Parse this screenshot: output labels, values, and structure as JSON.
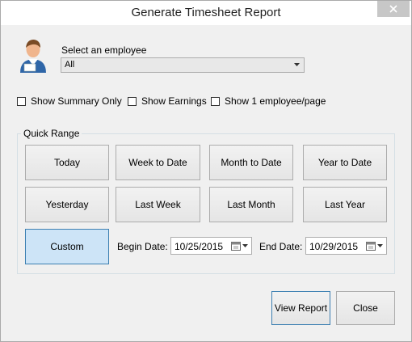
{
  "window": {
    "title": "Generate Timesheet Report"
  },
  "employee": {
    "label": "Select an employee",
    "selected": "All"
  },
  "options": [
    {
      "label": "Show Summary Only",
      "checked": false
    },
    {
      "label": "Show Earnings",
      "checked": false
    },
    {
      "label": "Show 1 employee/page",
      "checked": false
    }
  ],
  "quick_range": {
    "title": "Quick Range",
    "buttons": [
      "Today",
      "Week to Date",
      "Month to Date",
      "Year to Date",
      "Yesterday",
      "Last Week",
      "Last Month",
      "Last Year",
      "Custom"
    ],
    "selected": "Custom"
  },
  "dates": {
    "begin_label": "Begin Date:",
    "begin_value": "10/25/2015",
    "end_label": "End Date:",
    "end_value": "10/29/2015"
  },
  "actions": {
    "view_report": "View Report",
    "close": "Close"
  },
  "icons": {
    "user": "user-avatar-icon",
    "calendar": "calendar-icon",
    "dropdown": "chevron-down-icon",
    "close": "close-icon"
  }
}
